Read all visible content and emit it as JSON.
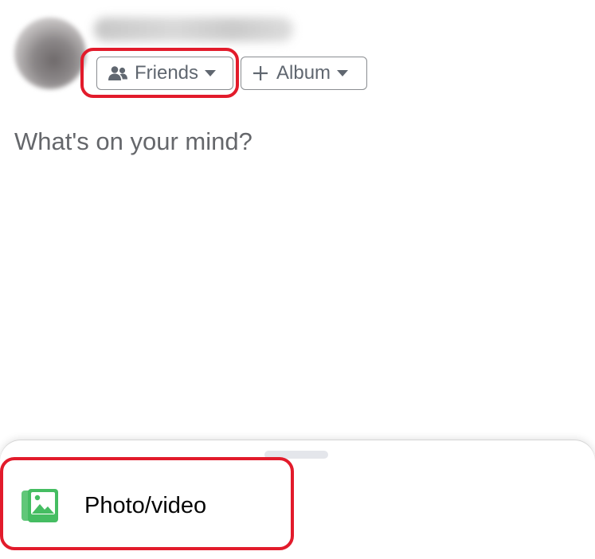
{
  "header": {
    "audience_label": "Friends",
    "album_label": "Album"
  },
  "composer": {
    "placeholder": "What's on your mind?"
  },
  "sheet": {
    "items": [
      {
        "label": "Photo/video",
        "icon": "photo-icon"
      }
    ]
  },
  "colors": {
    "highlight": "#e21b2b",
    "photo_icon": "#45bd62",
    "chip_text": "#606770"
  }
}
